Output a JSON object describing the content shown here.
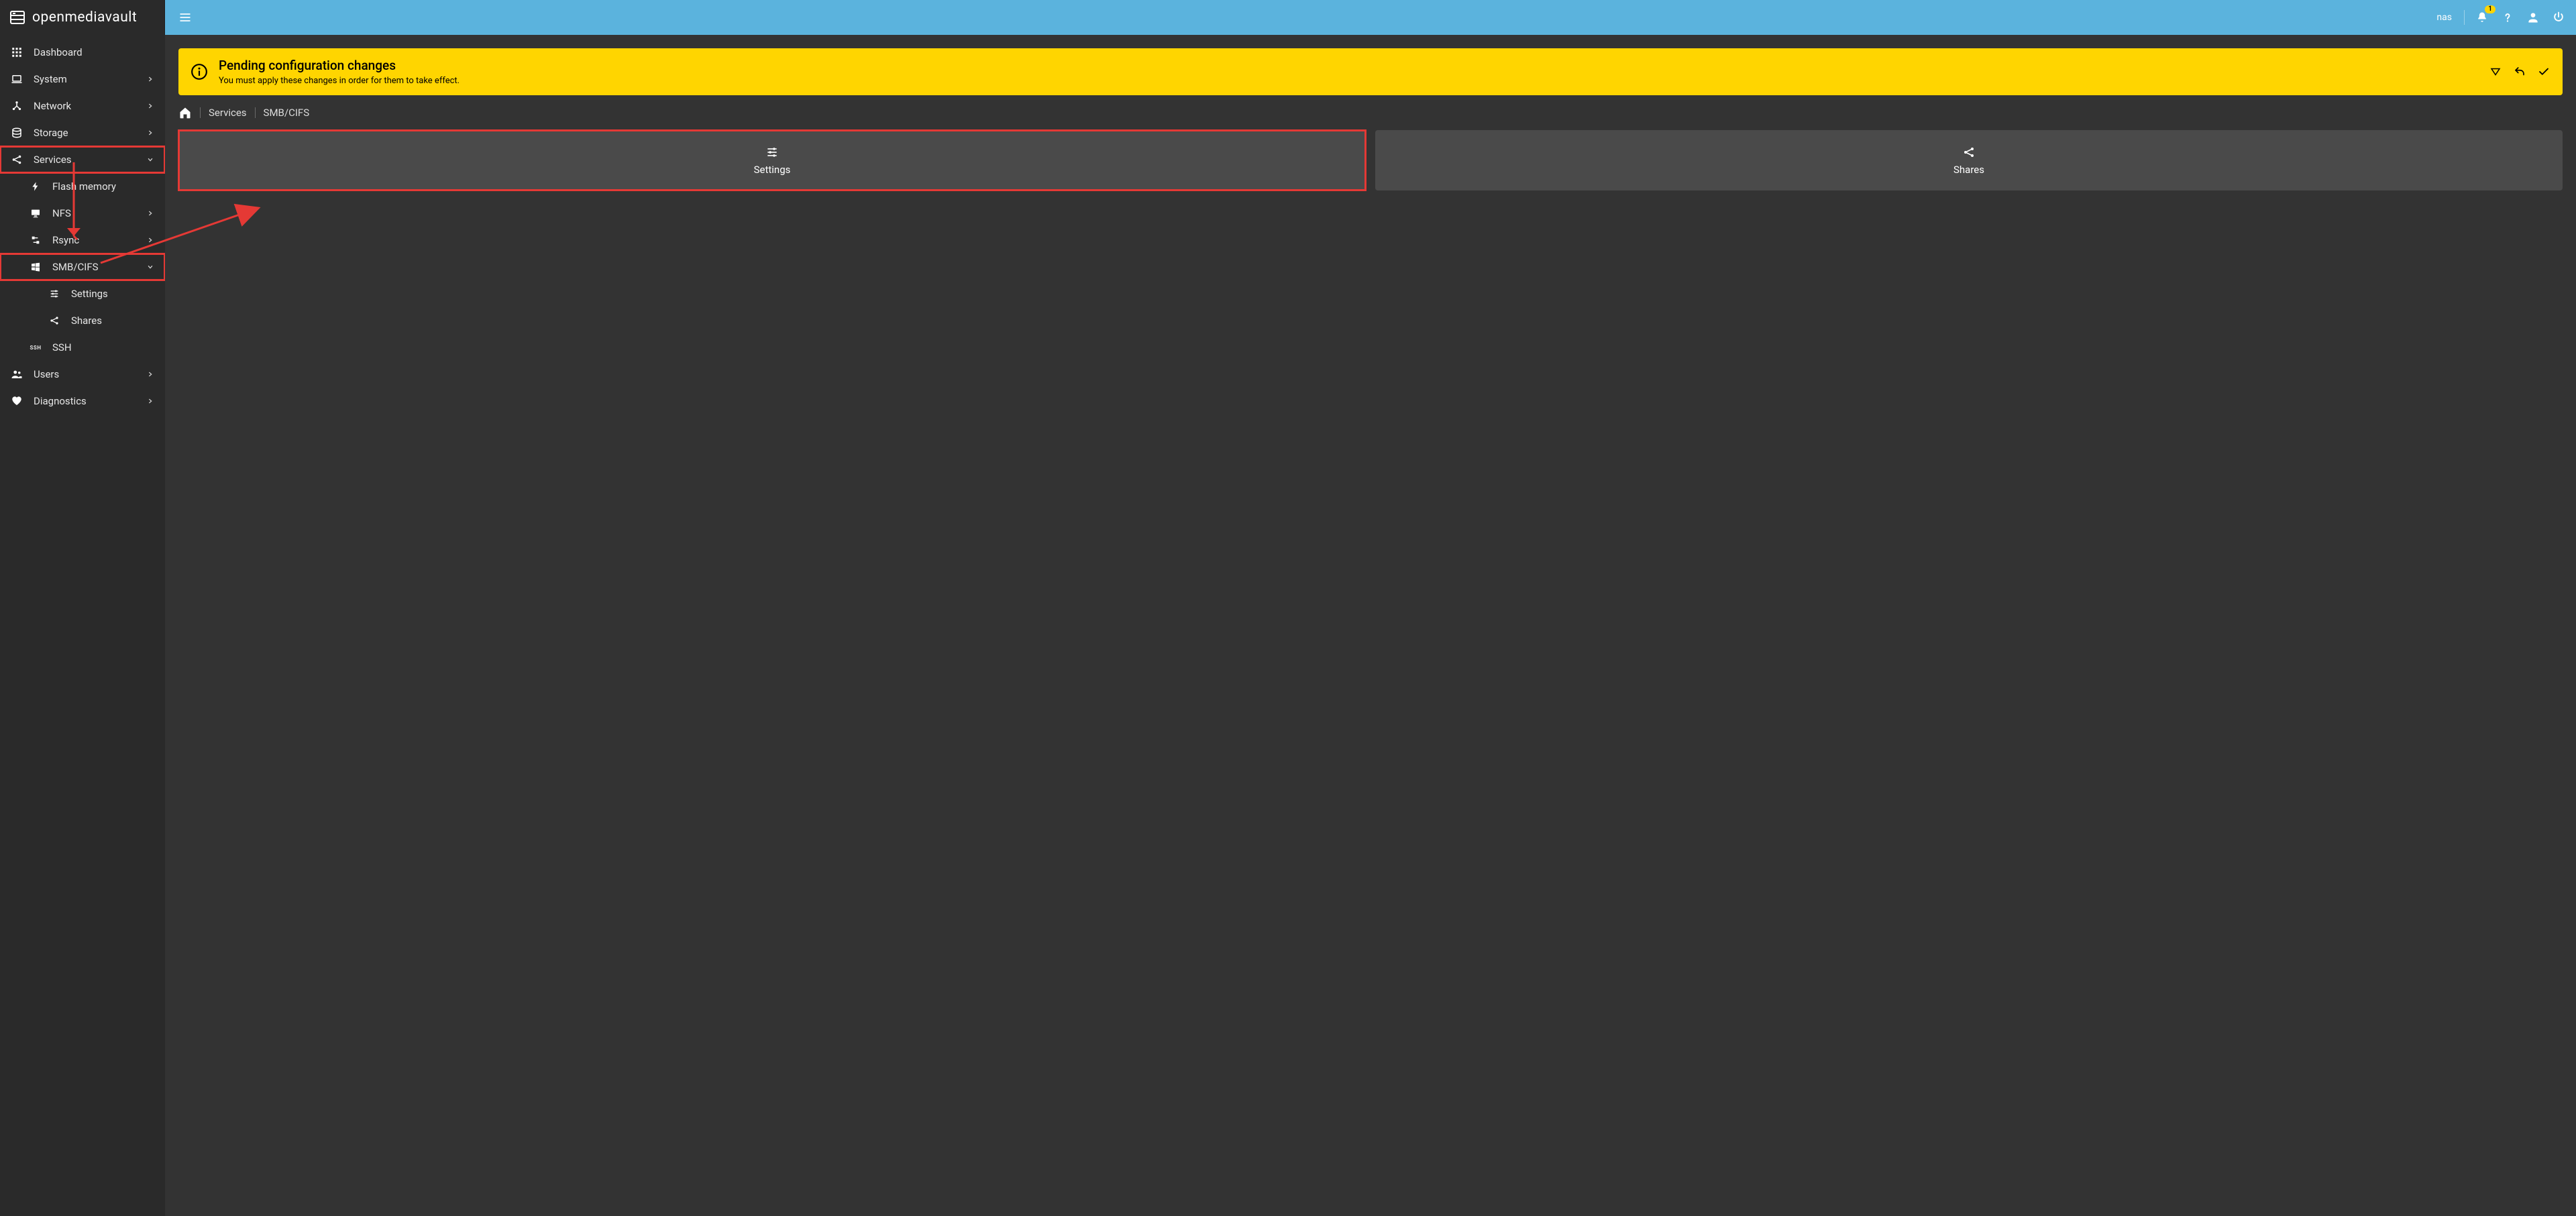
{
  "header": {
    "brand": "openmediavault",
    "hostname": "nas",
    "notification_count": "1"
  },
  "sidebar": {
    "dashboard": "Dashboard",
    "system": "System",
    "network": "Network",
    "storage": "Storage",
    "services": "Services",
    "services_sub": {
      "flash": "Flash memory",
      "nfs": "NFS",
      "rsync": "Rsync",
      "smb": "SMB/CIFS",
      "smb_sub": {
        "settings": "Settings",
        "shares": "Shares"
      },
      "ssh": "SSH"
    },
    "users": "Users",
    "diagnostics": "Diagnostics"
  },
  "banner": {
    "title": "Pending configuration changes",
    "subtitle": "You must apply these changes in order for them to take effect."
  },
  "breadcrumb": {
    "item1": "Services",
    "item2": "SMB/CIFS"
  },
  "cards": {
    "settings": "Settings",
    "shares": "Shares"
  }
}
